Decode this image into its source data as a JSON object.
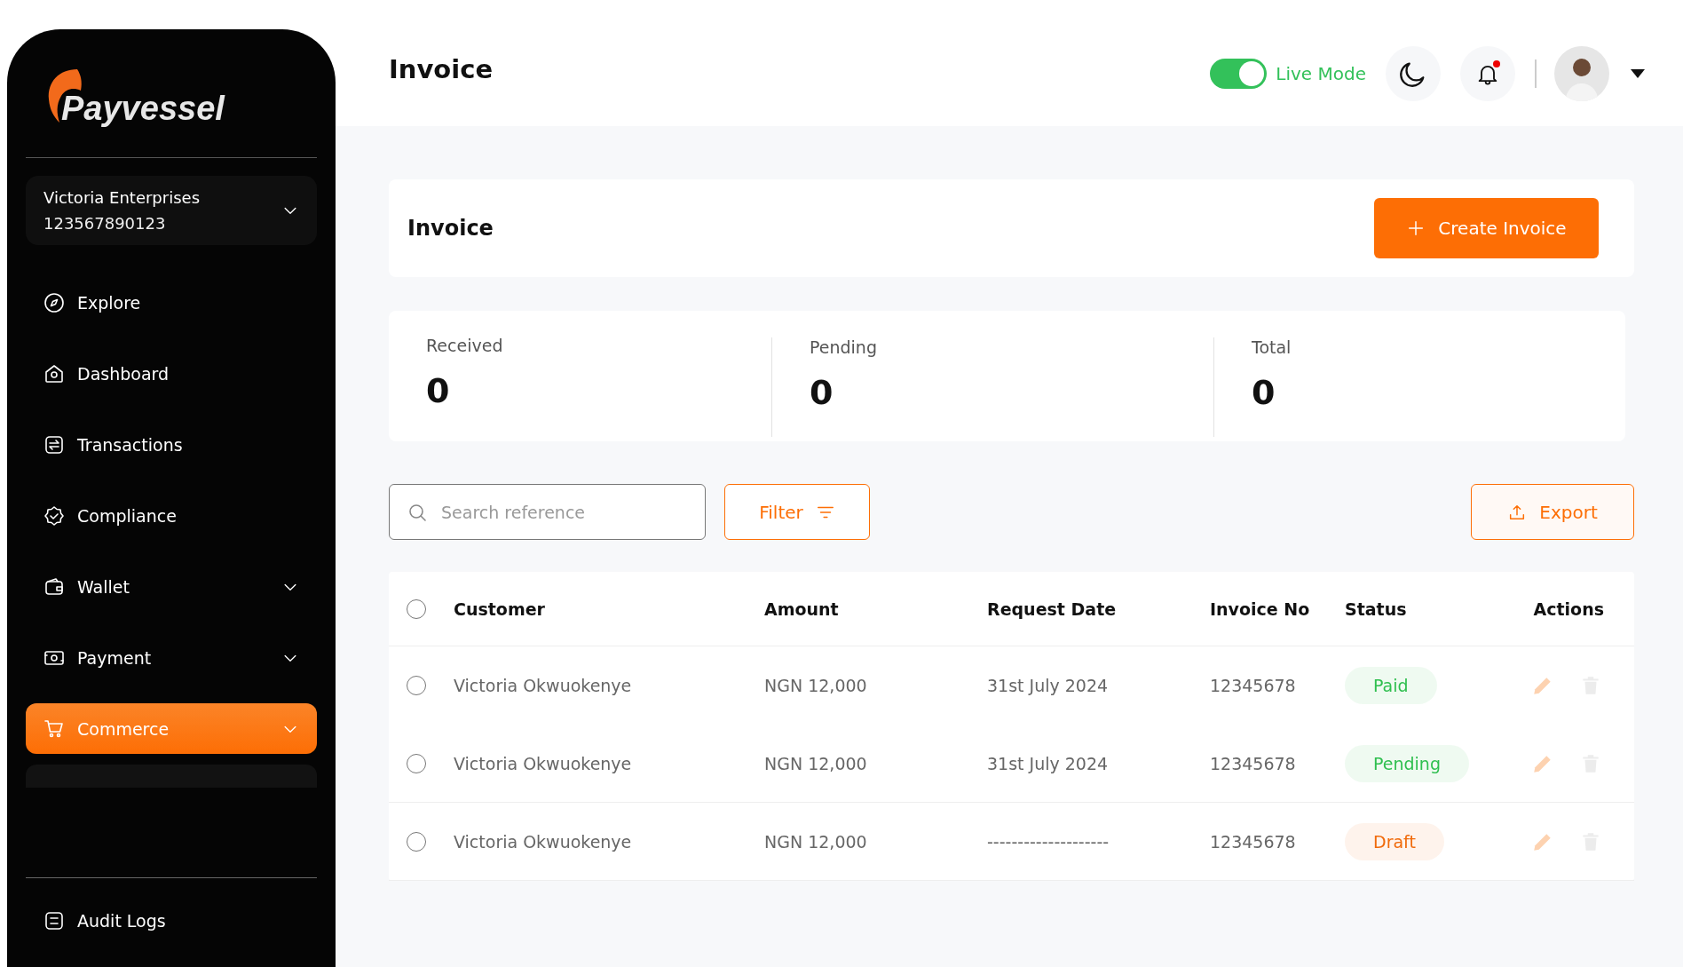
{
  "brand": {
    "name": "Payvessel"
  },
  "account": {
    "name": "Victoria Enterprises",
    "number": "123567890123"
  },
  "nav": [
    {
      "label": "Explore",
      "selected": false,
      "expandable": false
    },
    {
      "label": "Dashboard",
      "selected": false,
      "expandable": false
    },
    {
      "label": "Transactions",
      "selected": false,
      "expandable": false
    },
    {
      "label": "Compliance",
      "selected": false,
      "expandable": false
    },
    {
      "label": "Wallet",
      "selected": false,
      "expandable": true
    },
    {
      "label": "Payment",
      "selected": false,
      "expandable": true
    },
    {
      "label": "Commerce",
      "selected": true,
      "expandable": true
    }
  ],
  "nav_footer": {
    "label": "Audit Logs"
  },
  "header": {
    "title": "Invoice",
    "live_mode": {
      "label": "Live Mode",
      "on": true
    },
    "notifications": {
      "unread": true
    }
  },
  "panel": {
    "title": "Invoice",
    "create_button": "Create Invoice"
  },
  "stats": [
    {
      "label": "Received",
      "value": "0"
    },
    {
      "label": "Pending",
      "value": "0"
    },
    {
      "label": "Total",
      "value": "0"
    }
  ],
  "search": {
    "placeholder": "Search reference"
  },
  "filter_button": "Filter",
  "export_button": "Export",
  "table": {
    "columns": [
      "Customer",
      "Amount",
      "Request Date",
      "Invoice No",
      "Status",
      "Actions"
    ],
    "header_checked": false,
    "rows": [
      {
        "checked": false,
        "customer": "Victoria Okwuokenye",
        "amount": "NGN 12,000",
        "date": "31st July 2024",
        "invoice_no": "12345678",
        "status": {
          "label": "Paid",
          "color": "#2fbf4f"
        }
      },
      {
        "checked": false,
        "customer": "Victoria Okwuokenye",
        "amount": "NGN 12,000",
        "date": "31st July 2024",
        "invoice_no": "12345678",
        "status": {
          "label": "Pending",
          "color": "#2fbf4f"
        }
      },
      {
        "checked": false,
        "customer": "Victoria Okwuokenye",
        "amount": "NGN 12,000",
        "date": "--------------------",
        "invoice_no": "12345678",
        "status": {
          "label": "Draft",
          "color": "#f06a0a"
        }
      }
    ]
  }
}
